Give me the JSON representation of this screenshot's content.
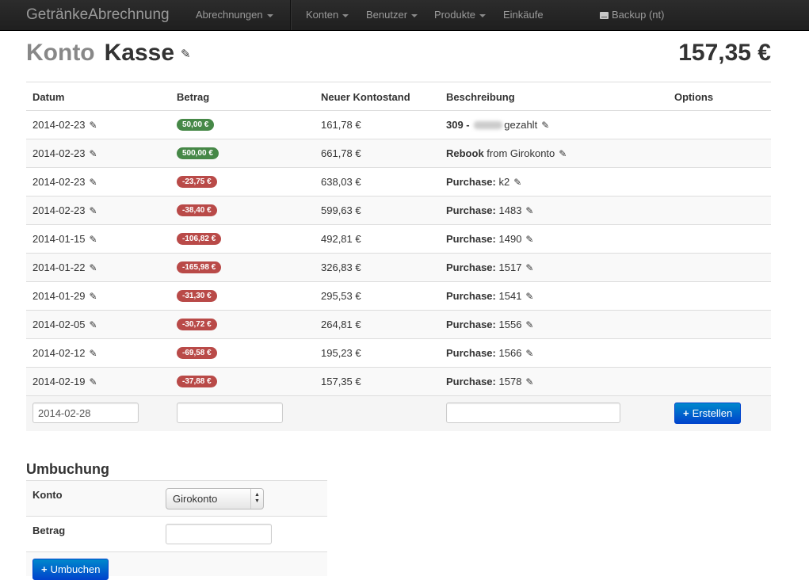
{
  "navbar": {
    "brand": "GetränkeAbrechnung",
    "abrechnungen": "Abrechnungen",
    "konten": "Konten",
    "benutzer": "Benutzer",
    "produkte": "Produkte",
    "einkaeufe": "Einkäufe",
    "backup": "Backup (nt)"
  },
  "header": {
    "label": "Konto",
    "account_name": "Kasse",
    "balance": "157,35 €"
  },
  "table": {
    "columns": [
      "Datum",
      "Betrag",
      "Neuer Kontostand",
      "Beschreibung",
      "Options"
    ],
    "rows": [
      {
        "date": "2014-02-23",
        "amount": "50,00 €",
        "type": "pos",
        "new_balance": "161,78 €",
        "desc_bold": "309 -",
        "desc_text": "gezahlt",
        "redacted": true
      },
      {
        "date": "2014-02-23",
        "amount": "500,00 €",
        "type": "pos",
        "new_balance": "661,78 €",
        "desc_bold": "Rebook",
        "desc_text": "from Girokonto"
      },
      {
        "date": "2014-02-23",
        "amount": "-23,75 €",
        "type": "neg",
        "new_balance": "638,03 €",
        "desc_bold": "Purchase:",
        "desc_text": "k2"
      },
      {
        "date": "2014-02-23",
        "amount": "-38,40 €",
        "type": "neg",
        "new_balance": "599,63 €",
        "desc_bold": "Purchase:",
        "desc_text": "1483"
      },
      {
        "date": "2014-01-15",
        "amount": "-106,82 €",
        "type": "neg",
        "new_balance": "492,81 €",
        "desc_bold": "Purchase:",
        "desc_text": "1490"
      },
      {
        "date": "2014-01-22",
        "amount": "-165,98 €",
        "type": "neg",
        "new_balance": "326,83 €",
        "desc_bold": "Purchase:",
        "desc_text": "1517"
      },
      {
        "date": "2014-01-29",
        "amount": "-31,30 €",
        "type": "neg",
        "new_balance": "295,53 €",
        "desc_bold": "Purchase:",
        "desc_text": "1541"
      },
      {
        "date": "2014-02-05",
        "amount": "-30,72 €",
        "type": "neg",
        "new_balance": "264,81 €",
        "desc_bold": "Purchase:",
        "desc_text": "1556"
      },
      {
        "date": "2014-02-12",
        "amount": "-69,58 €",
        "type": "neg",
        "new_balance": "195,23 €",
        "desc_bold": "Purchase:",
        "desc_text": "1566"
      },
      {
        "date": "2014-02-19",
        "amount": "-37,88 €",
        "type": "neg",
        "new_balance": "157,35 €",
        "desc_bold": "Purchase:",
        "desc_text": "1578"
      }
    ]
  },
  "new_entry": {
    "date_value": "2014-02-28",
    "amount_value": "",
    "description_value": "",
    "submit_label": "Erstellen"
  },
  "umbuchung": {
    "title": "Umbuchung",
    "konto_label": "Konto",
    "konto_selected": "Girokonto",
    "betrag_label": "Betrag",
    "betrag_value": "",
    "submit_label": "Umbuchen"
  },
  "colors": {
    "positive_badge": "#468847",
    "negative_badge": "#b94a48",
    "primary_button": "#0055cc",
    "navbar": "#222222"
  },
  "icons": [
    "pencil-icon",
    "hdd-icon",
    "plus-icon",
    "caret-down-icon",
    "select-arrows-icon"
  ]
}
